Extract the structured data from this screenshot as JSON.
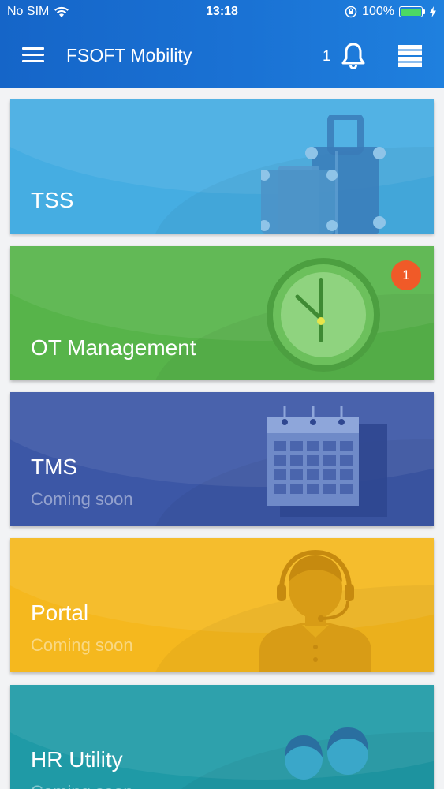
{
  "status_bar": {
    "carrier": "No SIM",
    "time": "13:18",
    "battery": "100%"
  },
  "app_bar": {
    "title": "FSOFT Mobility",
    "notification_count": "1"
  },
  "cards": [
    {
      "title": "TSS",
      "subtitle": "",
      "color": "#45ade2",
      "icon": "luggage-icon"
    },
    {
      "title": "OT Management",
      "subtitle": "",
      "color": "#57b44a",
      "icon": "clock-icon",
      "badge": "1"
    },
    {
      "title": "TMS",
      "subtitle": "Coming soon",
      "color": "#3c57a6",
      "icon": "calendar-icon"
    },
    {
      "title": "Portal",
      "subtitle": "Coming soon",
      "color": "#f5b81e",
      "icon": "support-agent-icon"
    },
    {
      "title": "HR Utility",
      "subtitle": "Coming soon",
      "color": "#1f9aa6",
      "icon": "people-icon"
    }
  ]
}
